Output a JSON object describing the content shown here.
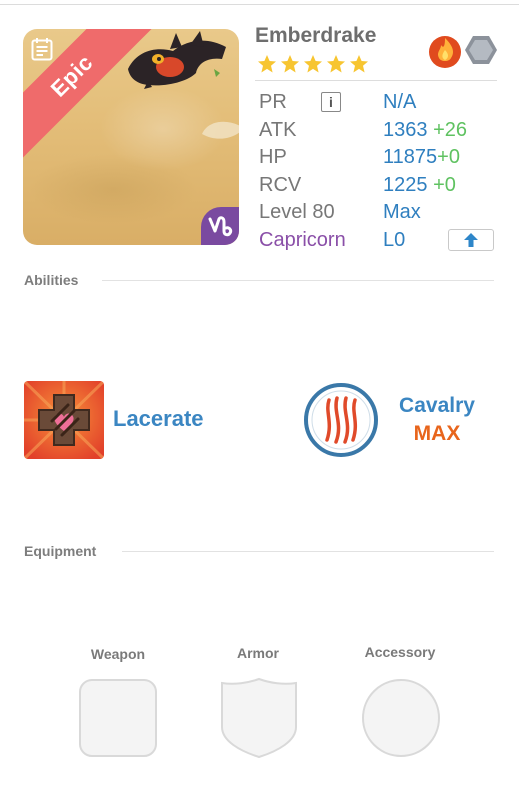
{
  "monster": {
    "name": "Emberdrake",
    "rarity": "Epic",
    "stars": 5,
    "elements": [
      "fire-element-icon",
      "metal-element-icon"
    ],
    "zodiac_icon": "capricorn-sign-icon"
  },
  "stats": {
    "pr": {
      "label": "PR",
      "value": "N/A"
    },
    "atk": {
      "label": "ATK",
      "value": "1363",
      "bonus": "+26"
    },
    "hp": {
      "label": "HP",
      "value": "11875",
      "bonus": "+0"
    },
    "rcv": {
      "label": "RCV",
      "value": "1225",
      "bonus": "+0"
    },
    "level": {
      "label": "Level 80",
      "value": "Max"
    },
    "sign": {
      "label": "Capricorn",
      "value": "L0"
    }
  },
  "abilities": {
    "title": "Abilities",
    "active": {
      "name": "Lacerate",
      "icon": "lacerate-icon"
    },
    "leader": {
      "name": "Cavalry",
      "level": "MAX",
      "icon": "claw-marks-icon"
    }
  },
  "equipment": {
    "title": "Equipment",
    "slots": [
      {
        "label": "Weapon",
        "shape": "rounded-square"
      },
      {
        "label": "Armor",
        "shape": "shield"
      },
      {
        "label": "Accessory",
        "shape": "circle"
      }
    ]
  },
  "colors": {
    "ribbon": "#ef6b6b",
    "stat_value": "#2f7fbf",
    "stat_bonus": "#5fc261",
    "sign_label": "#8a4fa8",
    "ability_name": "#3b86c2",
    "max_label": "#e8651c"
  }
}
